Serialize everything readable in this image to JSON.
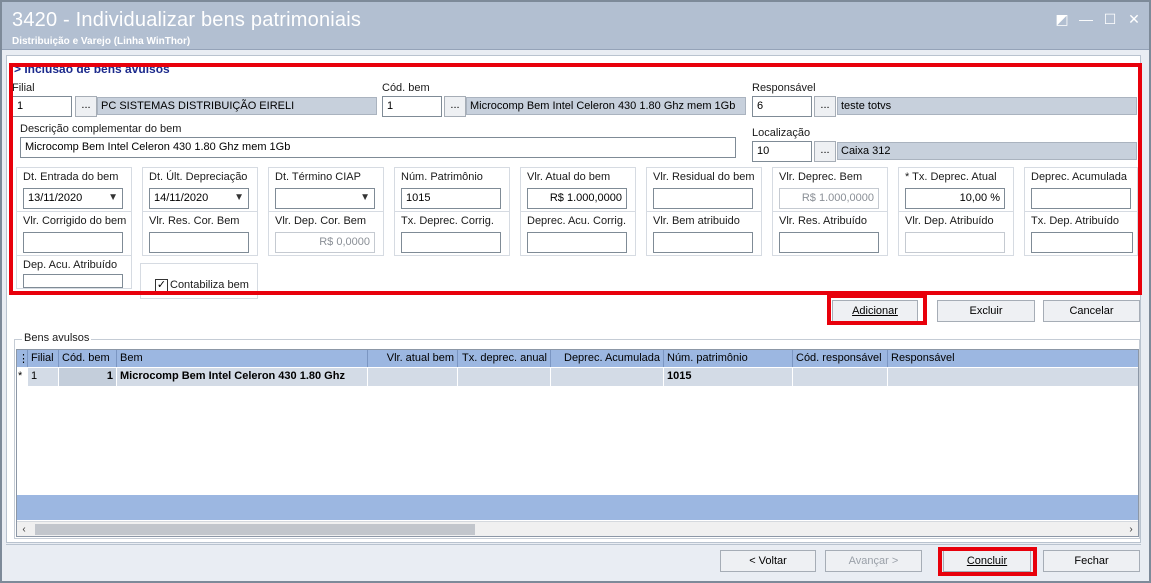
{
  "window": {
    "title": "3420 - Individualizar bens patrimoniais",
    "subtitle": "Distribuição e Varejo (Linha WinThor)",
    "controls": [
      "restore-icon",
      "minimize-icon",
      "maximize-icon",
      "close-icon"
    ]
  },
  "form": {
    "section_title": "> Inclusão de bens avulsos",
    "filial": {
      "label": "Filial",
      "code": "1",
      "name": "PC SISTEMAS DISTRIBUIÇÃO  EIRELI"
    },
    "cod_bem": {
      "label": "Cód. bem",
      "code": "1",
      "name": "Microcomp Bem Intel Celeron 430 1.80 Ghz mem 1Gb"
    },
    "responsavel": {
      "label": "Responsável",
      "code": "6",
      "name": "teste totvs"
    },
    "descricao": {
      "label": "Descrição complementar do bem",
      "value": "Microcomp Bem Intel Celeron 430 1.80 Ghz mem 1Gb"
    },
    "localizacao": {
      "label": "Localização",
      "code": "10",
      "name": "Caixa 312"
    },
    "dots": "...",
    "fields_row1": [
      {
        "label": "Dt. Entrada do bem",
        "value": "13/11/2020"
      },
      {
        "label": "Dt. Últ. Depreciação",
        "value": "14/11/2020"
      },
      {
        "label": "Dt. Término CIAP",
        "value": ""
      },
      {
        "label": "Núm. Patrimônio",
        "value": "1015"
      },
      {
        "label": "Vlr. Atual do bem",
        "value": "R$ 1.000,0000"
      },
      {
        "label": "Vlr. Residual do bem",
        "value": ""
      },
      {
        "label": "Vlr. Deprec. Bem",
        "value": "R$ 1.000,0000"
      },
      {
        "label": "* Tx. Deprec. Atual",
        "value": "10,00 %"
      },
      {
        "label": "Deprec. Acumulada",
        "value": ""
      }
    ],
    "fields_row2": [
      {
        "label": "Vlr. Corrigido do bem",
        "value": ""
      },
      {
        "label": "Vlr. Res. Cor. Bem",
        "value": ""
      },
      {
        "label": "Vlr. Dep. Cor. Bem",
        "value": "R$ 0,0000"
      },
      {
        "label": "Tx. Deprec. Corrig.",
        "value": ""
      },
      {
        "label": "Deprec. Acu. Corrig.",
        "value": ""
      },
      {
        "label": "Vlr. Bem atribuido",
        "value": ""
      },
      {
        "label": "Vlr. Res. Atribuído",
        "value": ""
      },
      {
        "label": "Vlr. Dep. Atribuído",
        "value": ""
      },
      {
        "label": "Tx. Dep. Atribuído",
        "value": ""
      }
    ],
    "dep_acu_atribuido": {
      "label": "Dep. Acu. Atribuído",
      "value": ""
    },
    "contabiliza": {
      "label": "Contabiliza bem",
      "checked": "✓"
    }
  },
  "actions": {
    "adicionar": "Adicionar",
    "excluir": "Excluir",
    "cancelar": "Cancelar"
  },
  "grid": {
    "group_label": "Bens avulsos",
    "columns": [
      "Filial",
      "Cód. bem",
      "Bem",
      "Vlr. atual bem",
      "Tx. deprec. anual",
      "Deprec. Acumulada",
      "Núm. patrimônio",
      "Cód. responsável",
      "Responsável"
    ],
    "rows": [
      {
        "marker": "*",
        "filial": "1",
        "cod_bem": "1",
        "bem": "Microcomp Bem Intel Celeron 430 1.80 Ghz",
        "vlr": "",
        "tx": "",
        "deprec": "",
        "num": "1015",
        "cod_resp": "",
        "resp": ""
      }
    ]
  },
  "footer": {
    "voltar": "< Voltar",
    "avancar": "Avançar >",
    "concluir": "Concluir",
    "fechar": "Fechar"
  },
  "colors": {
    "highlight": "#e8000b",
    "titlebar": "#b2bfd1",
    "grid_header": "#9cb7e1"
  }
}
